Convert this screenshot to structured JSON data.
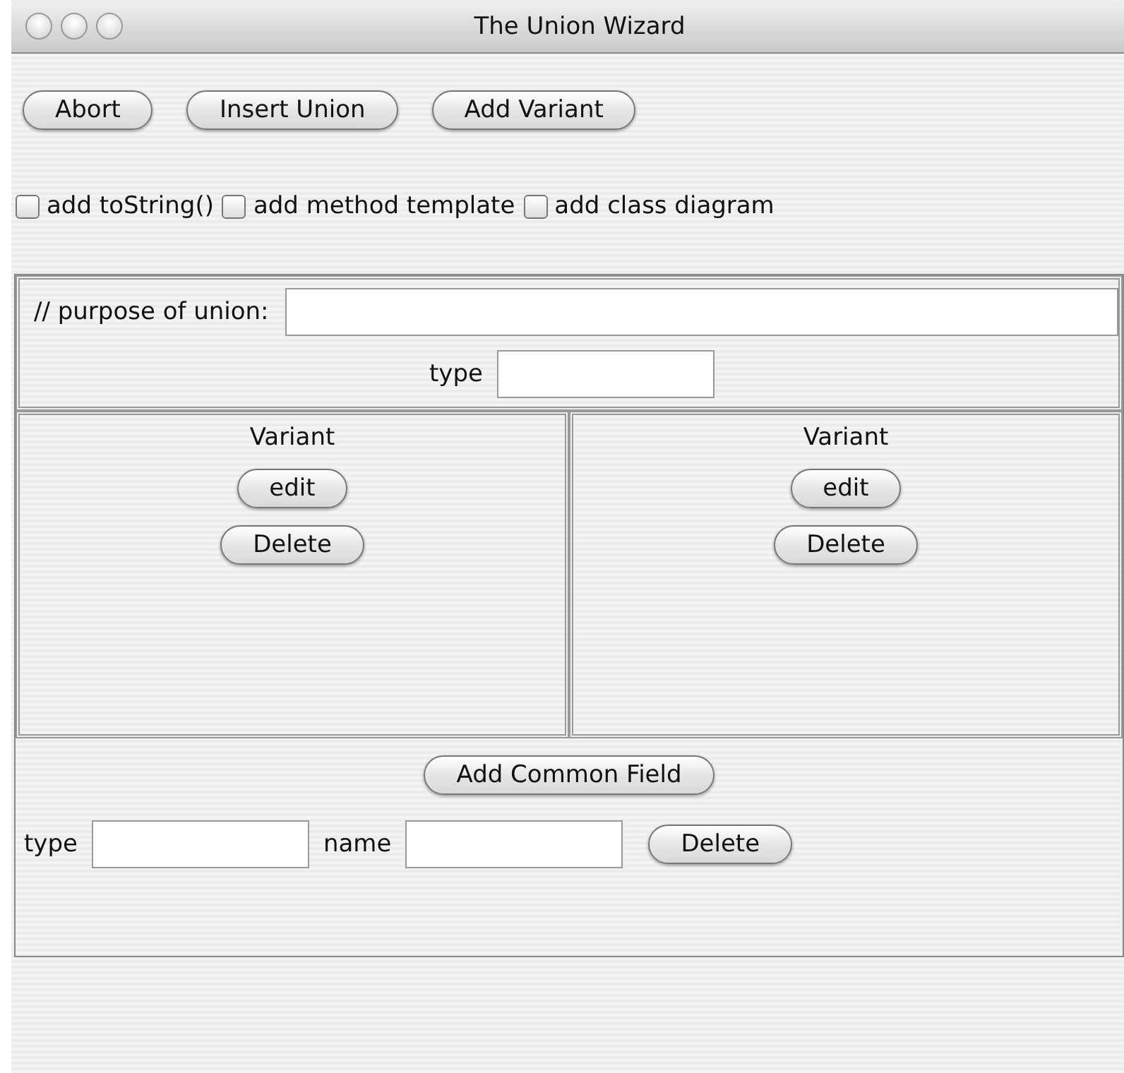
{
  "window": {
    "title": "The Union Wizard"
  },
  "toolbar": [
    "Abort",
    "Insert Union",
    "Add Variant"
  ],
  "options": [
    {
      "label": "add toString()",
      "checked": false
    },
    {
      "label": "add method template",
      "checked": false
    },
    {
      "label": "add class diagram",
      "checked": false
    }
  ],
  "purpose": {
    "label": "// purpose of union:",
    "type_label": "type"
  },
  "variants": [
    {
      "title": "Variant",
      "buttons": [
        "edit",
        "Delete"
      ]
    },
    {
      "title": "Variant",
      "buttons": [
        "edit",
        "Delete"
      ]
    }
  ],
  "common": {
    "button": "Add Common Field",
    "type_label": "type",
    "name_label": "name",
    "delete": "Delete"
  }
}
